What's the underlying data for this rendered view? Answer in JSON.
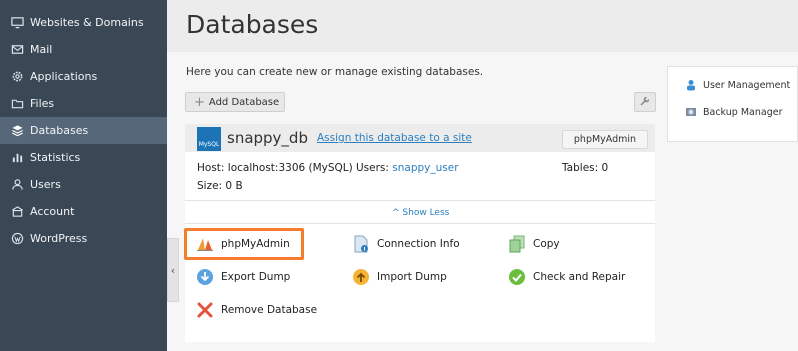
{
  "sidebar": {
    "items": [
      {
        "label": "Websites & Domains",
        "icon": "monitor-icon",
        "active": false
      },
      {
        "label": "Mail",
        "icon": "mail-icon",
        "active": false
      },
      {
        "label": "Applications",
        "icon": "gear-icon",
        "active": false
      },
      {
        "label": "Files",
        "icon": "folder-icon",
        "active": false
      },
      {
        "label": "Databases",
        "icon": "database-icon",
        "active": true
      },
      {
        "label": "Statistics",
        "icon": "bar-chart-icon",
        "active": false
      },
      {
        "label": "Users",
        "icon": "user-icon",
        "active": false
      },
      {
        "label": "Account",
        "icon": "account-icon",
        "active": false
      },
      {
        "label": "WordPress",
        "icon": "wordpress-icon",
        "active": false
      }
    ]
  },
  "page": {
    "title": "Databases",
    "intro": "Here you can create new or manage existing databases."
  },
  "toolbar": {
    "add_database": "Add Database"
  },
  "right_panel": {
    "user_management": "User Management",
    "backup_manager": "Backup Manager"
  },
  "database": {
    "logo_text": "MySQL",
    "name": "snappy_db",
    "assign_link": "Assign this database to a site",
    "phpmyadmin_button": "phpMyAdmin",
    "host": "Host: localhost:3306 (MySQL)",
    "users_label": "Users:",
    "users_value": "snappy_user",
    "tables": "Tables: 0",
    "size": "Size: 0 B",
    "show_less": "Show Less"
  },
  "actions": {
    "phpmyadmin": "phpMyAdmin",
    "connection_info": "Connection Info",
    "copy": "Copy",
    "export_dump": "Export Dump",
    "import_dump": "Import Dump",
    "check_repair": "Check and Repair",
    "remove_database": "Remove Database"
  },
  "colors": {
    "sidebar_bg": "#3a4856",
    "sidebar_active": "#56677a",
    "link": "#2b7fbf",
    "highlight": "#f47c2c"
  }
}
